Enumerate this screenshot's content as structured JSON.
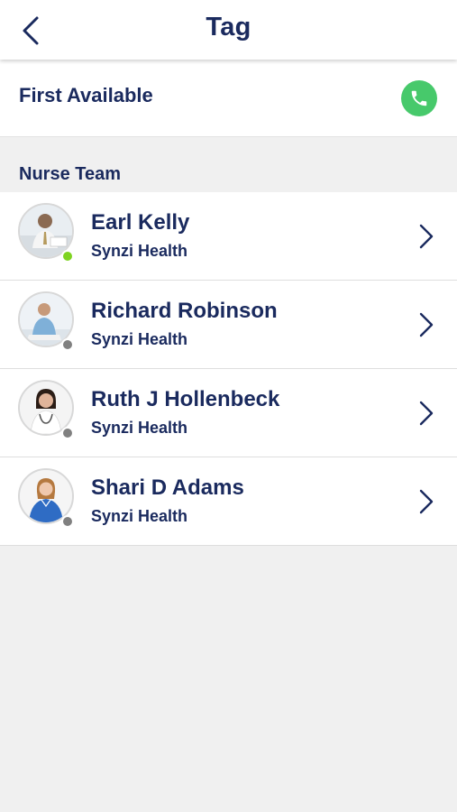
{
  "header": {
    "title": "Tag"
  },
  "first_available": {
    "label": "First Available"
  },
  "section": {
    "label": "Nurse Team"
  },
  "colors": {
    "navy": "#1a2a5e",
    "call_green": "#47c96b",
    "online": "#7ed321",
    "offline": "#808080"
  },
  "contacts": [
    {
      "name": "Earl Kelly",
      "org": "Synzi Health",
      "status": "online"
    },
    {
      "name": "Richard Robinson",
      "org": "Synzi Health",
      "status": "offline"
    },
    {
      "name": "Ruth J Hollenbeck",
      "org": "Synzi Health",
      "status": "offline"
    },
    {
      "name": "Shari D Adams",
      "org": "Synzi Health",
      "status": "offline"
    }
  ]
}
